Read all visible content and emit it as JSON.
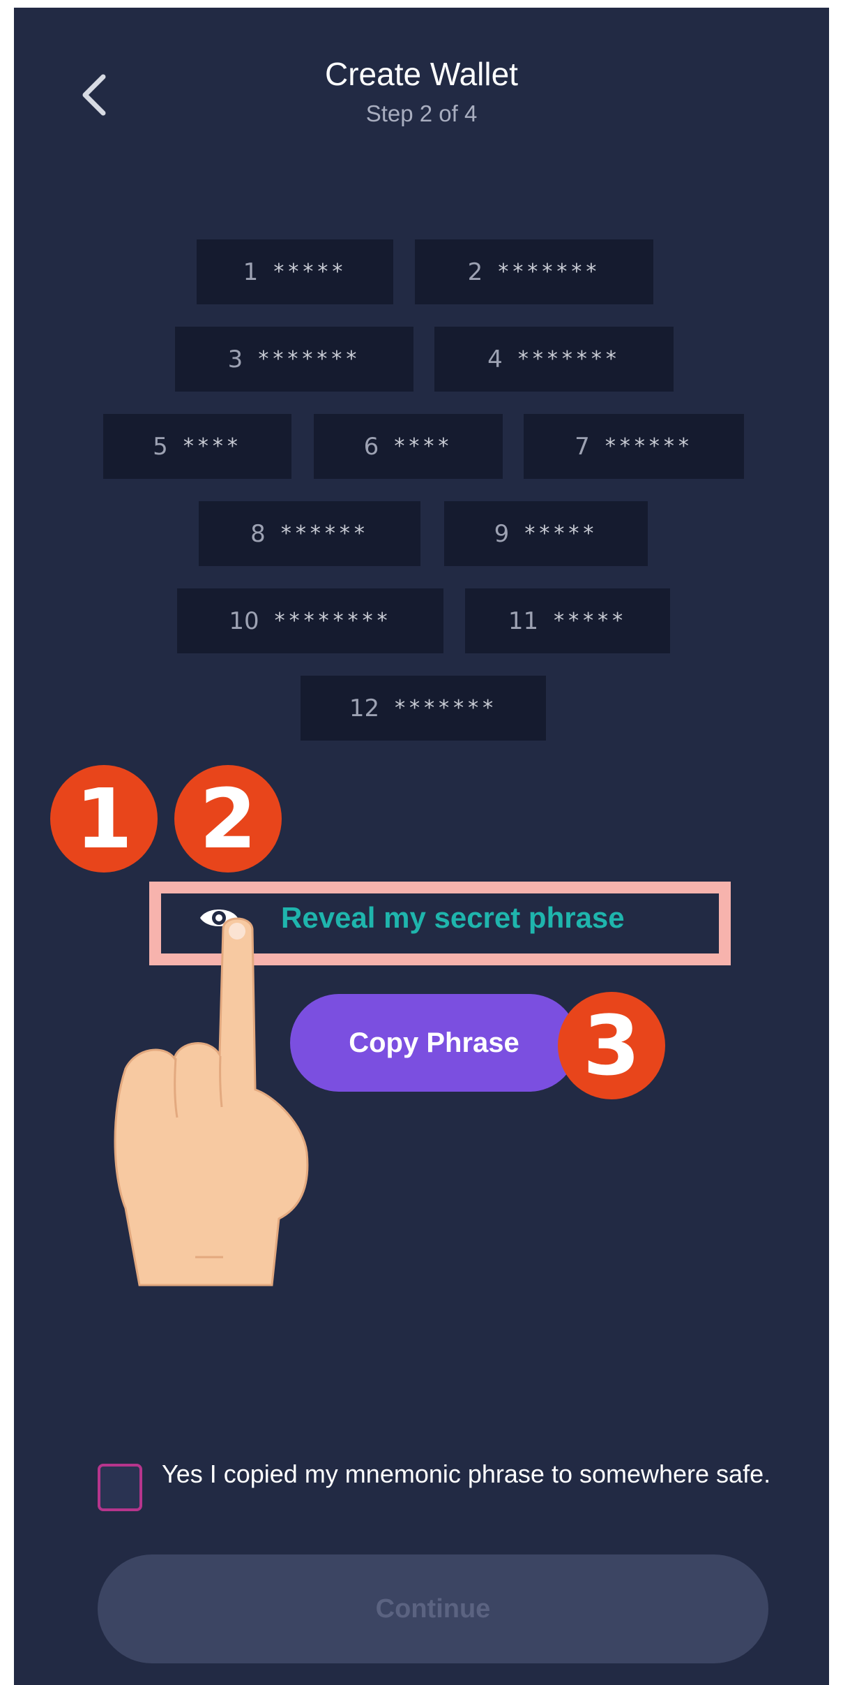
{
  "header": {
    "title": "Create Wallet",
    "step": "Step 2 of 4"
  },
  "words": [
    {
      "num": "1",
      "mask": "*****"
    },
    {
      "num": "2",
      "mask": "*******"
    },
    {
      "num": "3",
      "mask": "*******"
    },
    {
      "num": "4",
      "mask": "*******"
    },
    {
      "num": "5",
      "mask": "****"
    },
    {
      "num": "6",
      "mask": "****"
    },
    {
      "num": "7",
      "mask": "******"
    },
    {
      "num": "8",
      "mask": "******"
    },
    {
      "num": "9",
      "mask": "*****"
    },
    {
      "num": "10",
      "mask": "********"
    },
    {
      "num": "11",
      "mask": "*****"
    },
    {
      "num": "12",
      "mask": "*******"
    }
  ],
  "badges": [
    "1",
    "2",
    "3"
  ],
  "reveal_label": "Reveal my secret phrase",
  "copy_label": "Copy Phrase",
  "confirm_text": "Yes I copied my mnemonic phrase to somewhere safe.",
  "continue_label": "Continue",
  "colors": {
    "background": "#222a44",
    "chip": "#151b2f",
    "accent_reveal": "#1fb5ad",
    "copy_button": "#7b4fe0",
    "badge": "#e8451b",
    "highlight": "#f7b3ad"
  },
  "icons": [
    "back-arrow-icon",
    "eye-icon",
    "pointing-hand-icon"
  ]
}
